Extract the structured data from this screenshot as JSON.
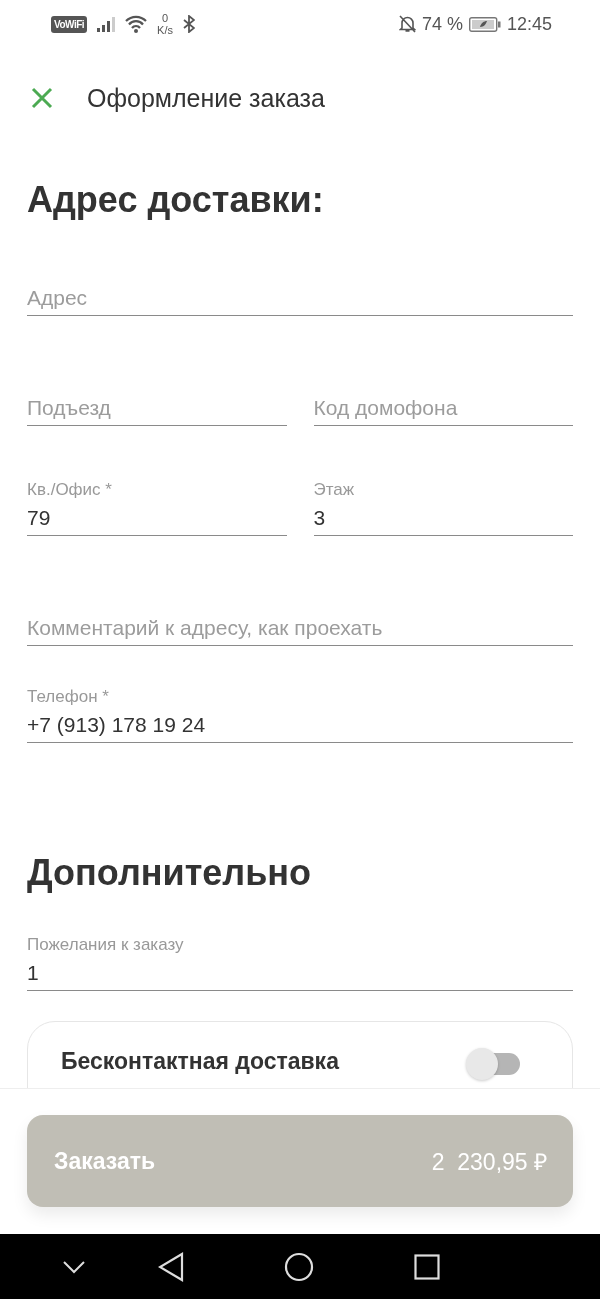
{
  "status_bar": {
    "vowifi": "VoWiFi",
    "speed_value": "0",
    "speed_unit": "K/s",
    "battery": "74 %",
    "time": "12:45"
  },
  "header": {
    "title": "Оформление заказа"
  },
  "address": {
    "heading": "Адрес доставки:",
    "rows": [
      {
        "fields": [
          {
            "placeholder": "Адрес"
          }
        ]
      },
      {
        "fields": [
          {
            "placeholder": "Подъезд"
          },
          {
            "placeholder": "Код домофона"
          }
        ]
      },
      {
        "fields": [
          {
            "label": "Кв./Офис *",
            "value": "79"
          },
          {
            "label": "Этаж",
            "value": "3"
          }
        ]
      },
      {
        "fields": [
          {
            "placeholder": "Комментарий к адресу, как проехать"
          }
        ]
      },
      {
        "fields": [
          {
            "label": "Телефон *",
            "value": "+7 (913) 178 19 24"
          }
        ]
      }
    ]
  },
  "extra": {
    "heading": "Дополнительно",
    "rows": [
      {
        "fields": [
          {
            "label": "Пожелания к заказу",
            "value": "1"
          }
        ]
      }
    ],
    "options": [
      {
        "label": "Бесконтактная доставка",
        "on": false
      }
    ]
  },
  "order_button": {
    "label": "Заказать",
    "total": "2  230,95 ₽"
  }
}
